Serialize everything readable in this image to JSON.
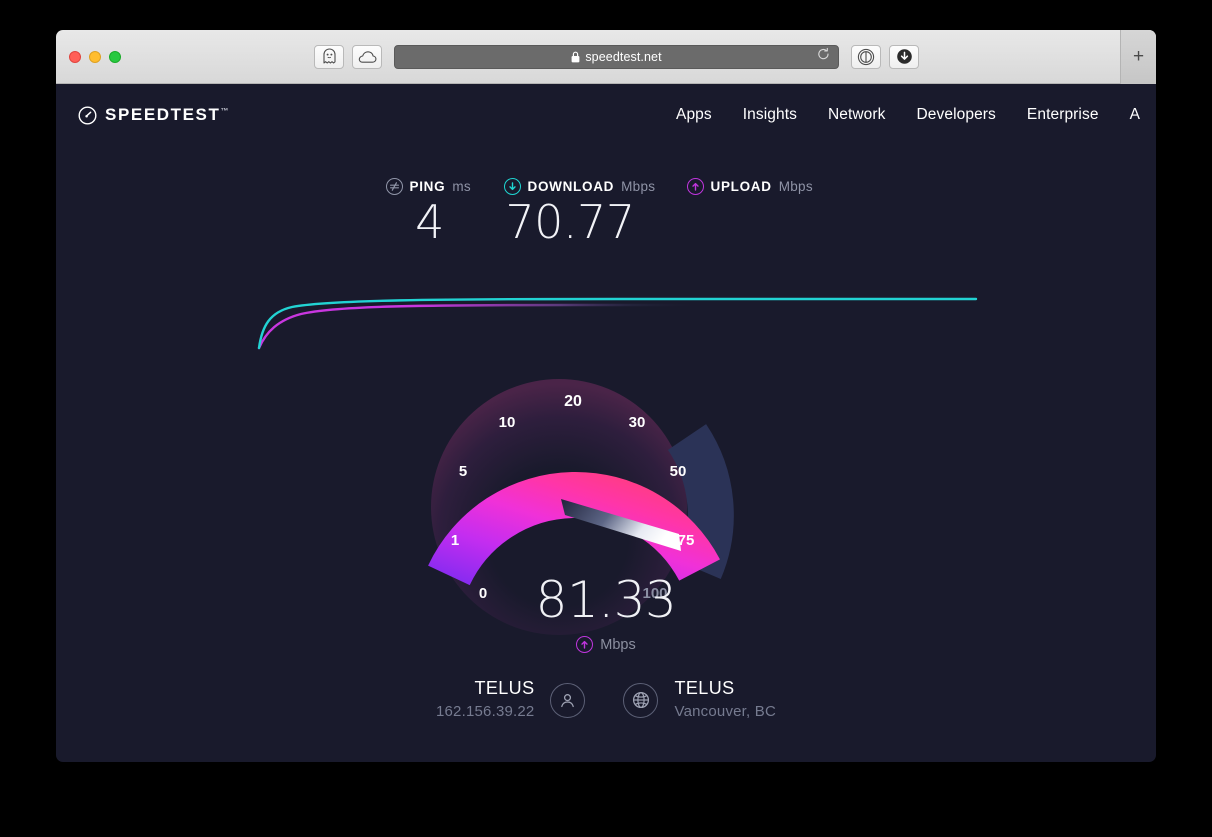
{
  "browser": {
    "url": "speedtest.net",
    "lock_icon": "lock-icon",
    "reload_icon": "reload-icon",
    "ghost_icon": "ghost-icon",
    "cloud_icon": "cloud-icon",
    "reader_icon": "reader-mode-icon",
    "download_icon": "downloads-icon",
    "new_tab_label": "+"
  },
  "site": {
    "logo_text": "SPEEDTEST",
    "logo_tm": "™",
    "logo_icon": "speedometer-icon",
    "nav": [
      {
        "label": "Apps"
      },
      {
        "label": "Insights"
      },
      {
        "label": "Network"
      },
      {
        "label": "Developers"
      },
      {
        "label": "Enterprise"
      },
      {
        "label": "A"
      }
    ]
  },
  "stats": {
    "ping": {
      "label": "PING",
      "unit": "ms",
      "value": "4",
      "icon": "ping-icon",
      "color": "#9095a8"
    },
    "download": {
      "label": "DOWNLOAD",
      "unit": "Mbps",
      "value": "70.77",
      "icon": "download-arrow-icon",
      "color": "#1fd6d2"
    },
    "upload": {
      "label": "UPLOAD",
      "unit": "Mbps",
      "value": "",
      "icon": "upload-arrow-icon",
      "color": "#bf35dd"
    }
  },
  "gauge": {
    "value": "81.33",
    "unit": "Mbps",
    "unit_icon": "upload-arrow-icon",
    "ticks": [
      "0",
      "1",
      "5",
      "10",
      "20",
      "30",
      "50",
      "75",
      "100"
    ],
    "min": 0,
    "max": 100,
    "needle_value": 81.33,
    "fill_start_color": "#8b2bf0",
    "fill_mid_color": "#e02fd6",
    "fill_end_color": "#ff3d96",
    "track_color": "#2b3357"
  },
  "info": {
    "connection": {
      "title": "TELUS",
      "subtitle": "162.156.39.22",
      "icon": "person-icon"
    },
    "server": {
      "title": "TELUS",
      "subtitle": "Vancouver, BC",
      "icon": "globe-icon"
    }
  },
  "chart_data": {
    "type": "line",
    "title": "",
    "series": [
      {
        "name": "download",
        "color": "#22d3d3",
        "x": [
          0,
          3,
          6,
          10,
          16,
          24,
          40,
          60,
          80,
          100
        ],
        "y": [
          0,
          48,
          74,
          88,
          95,
          98,
          99,
          99.5,
          99.5,
          99.5
        ]
      },
      {
        "name": "upload",
        "color": "#c936e0",
        "x": [
          0,
          3,
          6,
          10,
          16,
          24,
          40,
          60,
          80,
          100
        ],
        "y": [
          0,
          26,
          52,
          72,
          86,
          94,
          97,
          98,
          98,
          98
        ]
      }
    ],
    "xlabel": "",
    "ylabel": "",
    "grid": false,
    "legend": "none"
  }
}
